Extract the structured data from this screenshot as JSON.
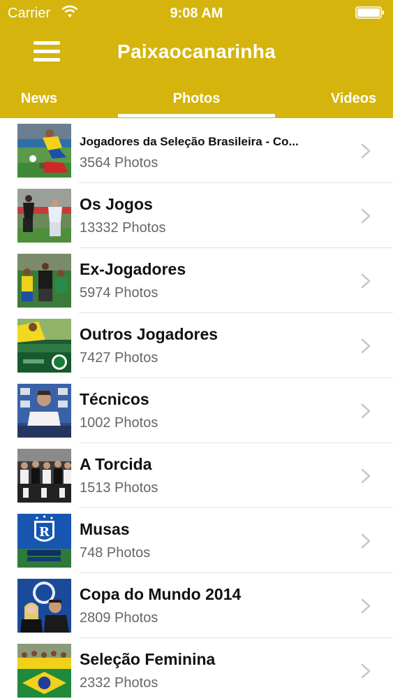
{
  "status_bar": {
    "carrier": "Carrier",
    "time": "9:08 AM"
  },
  "nav": {
    "title": "Paixaocanarinha"
  },
  "tabs": [
    {
      "label": "News"
    },
    {
      "label": "Photos"
    },
    {
      "label": "Videos"
    }
  ],
  "albums": [
    {
      "title": "Jogadores da Seleção Brasileira - Co...",
      "count": "3564 Photos"
    },
    {
      "title": "Os Jogos",
      "count": "13332 Photos"
    },
    {
      "title": "Ex-Jogadores",
      "count": "5974 Photos"
    },
    {
      "title": "Outros Jogadores",
      "count": "7427 Photos"
    },
    {
      "title": "Técnicos",
      "count": "1002 Photos"
    },
    {
      "title": "A Torcida",
      "count": "1513 Photos"
    },
    {
      "title": "Musas",
      "count": "748 Photos"
    },
    {
      "title": "Copa do Mundo 2014",
      "count": "2809 Photos"
    },
    {
      "title": "Seleção Feminina",
      "count": "2332 Photos"
    }
  ],
  "colors": {
    "header": "#d5b50d",
    "header_text": "#ffffff",
    "count_text": "#666666",
    "chevron": "#c7c7cc"
  },
  "icons": {
    "menu": "hamburger-menu-icon",
    "row_disclosure": "chevron-right-icon",
    "wifi": "wifi-icon",
    "battery": "battery-icon"
  }
}
